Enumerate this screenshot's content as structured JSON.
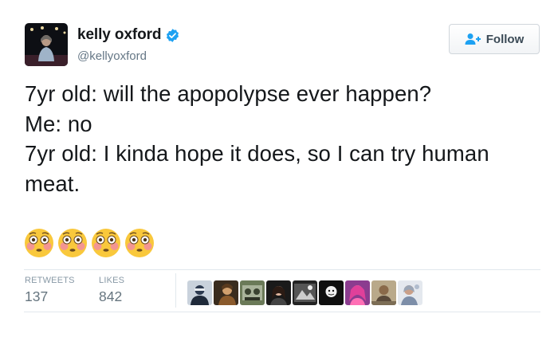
{
  "user": {
    "display_name": "kelly oxford",
    "handle": "@kellyoxford",
    "verified": true,
    "avatar_icon": "profile-photo-icon"
  },
  "follow_button": {
    "label": "Follow",
    "icon": "add-user-icon"
  },
  "tweet": {
    "lines": [
      "7yr old: will the apopolypse ever happen?",
      "Me: no",
      "7yr old: I kinda hope it does, so I can try human",
      "meat."
    ],
    "emoji": [
      "flushed-face-icon",
      "flushed-face-icon",
      "flushed-face-icon",
      "flushed-face-icon"
    ]
  },
  "stats": {
    "retweets_label": "RETWEETS",
    "retweets_value": "137",
    "likes_label": "LIKES",
    "likes_value": "842"
  },
  "likers": [
    "liker-avatar-icon",
    "liker-avatar-icon",
    "liker-avatar-icon",
    "liker-avatar-icon",
    "liker-avatar-icon",
    "liker-avatar-icon",
    "liker-avatar-icon",
    "liker-avatar-icon",
    "liker-avatar-icon"
  ],
  "colors": {
    "text": "#14171a",
    "secondary": "#657786",
    "verified_blue": "#1da1f2",
    "divider": "#e1e8ed"
  }
}
